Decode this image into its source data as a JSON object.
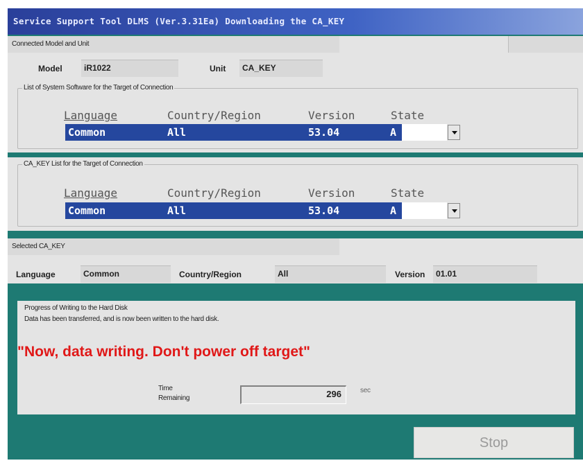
{
  "window": {
    "title": "Service Support Tool DLMS (Ver.3.31Ea) Downloading the CA_KEY"
  },
  "connected": {
    "heading": "Connected Model and Unit",
    "model_label": "Model",
    "model_value": "iR1022",
    "unit_label": "Unit",
    "unit_value": "CA_KEY"
  },
  "system_software": {
    "legend": "List of System Software for the Target of Connection",
    "headers": [
      "Language",
      "Country/Region",
      "Version",
      "State"
    ],
    "row": {
      "language": "Common",
      "country": "All",
      "version": "53.04",
      "state": "A"
    }
  },
  "cakey_list": {
    "legend": "CA_KEY List for the Target of Connection",
    "headers": [
      "Language",
      "Country/Region",
      "Version",
      "State"
    ],
    "row": {
      "language": "Common",
      "country": "All",
      "version": "53.04",
      "state": "A"
    }
  },
  "selected": {
    "heading": "Selected CA_KEY",
    "language_label": "Language",
    "language_value": "Common",
    "country_label": "Country/Region",
    "country_value": "All",
    "version_label": "Version",
    "version_value": "01.01"
  },
  "progress": {
    "legend": "Progress of Writing to the Hard Disk",
    "message": "Data has been transferred, and is now been written to the hard disk.",
    "warning": "\"Now, data writing. Don't power off target\"",
    "time_label_1": "Time",
    "time_label_2": "Remaining",
    "time_value": "296",
    "time_unit": "sec"
  },
  "buttons": {
    "stop": "Stop"
  },
  "colors": {
    "background": "#1e7a73",
    "selection": "#25479e",
    "warning": "#e01818"
  }
}
